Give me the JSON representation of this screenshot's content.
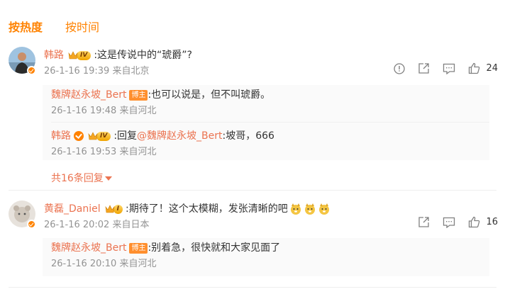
{
  "sort_tabs": [
    {
      "label": "按热度",
      "active": true
    },
    {
      "label": "按时间",
      "active": false
    }
  ],
  "comments": [
    {
      "user": "韩路",
      "vip_level": "IV",
      "text": ":这是传说中的“琥爵”?",
      "meta": "26-1-16 19:39 来自北京",
      "like_count": "24",
      "replies": [
        {
          "user": "魏牌赵永坡_Bert",
          "badge": "博主",
          "text": ":也可以说是，但不叫琥爵。",
          "meta": "26-1-16 19:48 来自河北"
        },
        {
          "user": "韩路",
          "vip_level": "IV",
          "prefix": ":回复",
          "mention": "@魏牌赵永坡_Bert",
          "text": ":坡哥，666",
          "meta": "26-1-16 19:53 来自河北"
        }
      ],
      "more_replies": "共16条回复"
    },
    {
      "user": "黄磊_Daniel",
      "vip_level": "I",
      "text": ":期待了！这个太模糊，发张清晰的吧",
      "meta": "26-1-16 20:02 来自日本",
      "like_count": "16",
      "replies": [
        {
          "user": "魏牌赵永坡_Bert",
          "badge": "博主",
          "text": ":别着急，很快就和大家见面了",
          "meta": "26-1-16 20:10 来自河北"
        }
      ]
    }
  ],
  "icons": {
    "report": "alert-circle-icon",
    "forward": "share-icon",
    "comment": "comment-icon",
    "like": "thumbs-up-icon"
  },
  "colors": {
    "accent": "#ff8200",
    "username": "#eb7350",
    "meta": "#939393"
  }
}
